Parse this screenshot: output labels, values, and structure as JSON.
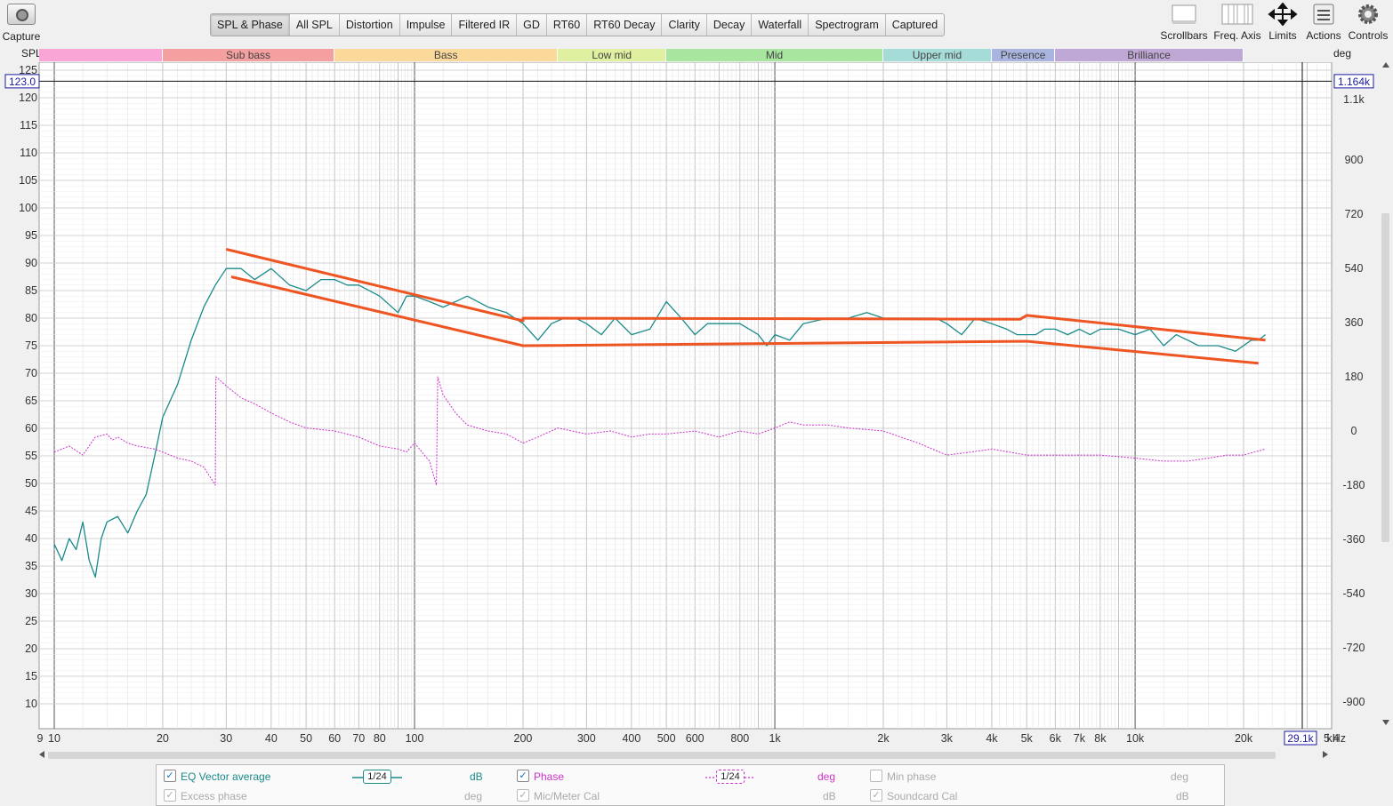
{
  "capture": {
    "label": "Capture"
  },
  "tabs": [
    "SPL & Phase",
    "All SPL",
    "Distortion",
    "Impulse",
    "Filtered IR",
    "GD",
    "RT60",
    "RT60 Decay",
    "Clarity",
    "Decay",
    "Waterfall",
    "Spectrogram",
    "Captured"
  ],
  "active_tab": "SPL & Phase",
  "tools": {
    "scrollbars": "Scrollbars",
    "freq_axis": "Freq. Axis",
    "limits": "Limits",
    "actions": "Actions",
    "controls": "Controls"
  },
  "bands": [
    {
      "label": "",
      "color": "#f9a6d6"
    },
    {
      "label": "Sub bass",
      "color": "#f5a0a0"
    },
    {
      "label": "Bass",
      "color": "#fbd99b"
    },
    {
      "label": "Low mid",
      "color": "#dff0a0"
    },
    {
      "label": "Mid",
      "color": "#a8e6a0"
    },
    {
      "label": "Upper mid",
      "color": "#a6dcd8"
    },
    {
      "label": "Presence",
      "color": "#a9b5e0"
    },
    {
      "label": "Brilliance",
      "color": "#c0a8d6"
    }
  ],
  "axes": {
    "left_title": "SPL",
    "right_title": "deg",
    "spl_ticks": [
      "125",
      "120",
      "115",
      "110",
      "105",
      "100",
      "95",
      "90",
      "85",
      "80",
      "75",
      "70",
      "65",
      "60",
      "55",
      "50",
      "45",
      "40",
      "35",
      "30",
      "25",
      "20",
      "15",
      "10"
    ],
    "deg_ticks": [
      "1.1k",
      "900",
      "720",
      "540",
      "360",
      "180",
      "0",
      "-180",
      "-360",
      "-540",
      "-720",
      "-900"
    ],
    "freq_ticks": [
      "9",
      "10",
      "20",
      "30",
      "40",
      "50",
      "60",
      "70",
      "80",
      "100",
      "200",
      "300",
      "400",
      "500",
      "600",
      "800",
      "1k",
      "2k",
      "3k",
      "4k",
      "5k",
      "6k",
      "7k",
      "8k",
      "10k",
      "20k"
    ],
    "freq_unit": "kHz",
    "freq_end": "5.4",
    "cursor_spl": "123.0",
    "cursor_deg": "1.164k",
    "cursor_freq": "29.1k"
  },
  "chart_data": {
    "type": "line",
    "x_scale": "log",
    "xlim": [
      9,
      35000
    ],
    "ylim": [
      5,
      127
    ],
    "xlabel": "",
    "ylabel": "SPL",
    "y2label": "deg",
    "series": [
      {
        "name": "EQ Vector average",
        "color": "#1a8a8a",
        "unit": "dB",
        "x": [
          10,
          10.5,
          11,
          11.5,
          12,
          12.5,
          13,
          13.5,
          14,
          15,
          16,
          17,
          18,
          19,
          20,
          22,
          24,
          26,
          28,
          30,
          33,
          36,
          40,
          45,
          50,
          55,
          60,
          65,
          70,
          80,
          90,
          95,
          100,
          110,
          120,
          130,
          140,
          160,
          180,
          200,
          220,
          240,
          260,
          280,
          300,
          330,
          360,
          400,
          450,
          500,
          550,
          600,
          650,
          700,
          800,
          900,
          950,
          1000,
          1100,
          1200,
          1400,
          1600,
          1800,
          2000,
          2200,
          2500,
          2800,
          3000,
          3300,
          3600,
          4000,
          4400,
          4700,
          5000,
          5300,
          5600,
          6000,
          6500,
          7000,
          7500,
          8000,
          8500,
          9000,
          10000,
          11000,
          12000,
          13000,
          14000,
          15000,
          17000,
          19000,
          20000,
          21000,
          22000,
          23000
        ],
        "y": [
          39,
          36,
          40,
          38,
          43,
          36,
          33,
          40,
          43,
          44,
          41,
          45,
          48,
          55,
          62,
          68,
          76,
          82,
          86,
          89,
          89,
          87,
          89,
          86,
          85,
          87,
          87,
          86,
          86,
          84,
          81,
          84,
          84,
          83,
          82,
          83,
          84,
          82,
          81,
          79,
          76,
          79,
          80,
          80,
          79,
          77,
          80,
          77,
          78,
          83,
          80,
          77,
          79,
          79,
          79,
          77,
          75,
          77,
          76,
          79,
          80,
          80,
          81,
          80,
          80,
          80,
          80,
          79,
          77,
          80,
          79,
          78,
          77,
          77,
          77,
          78,
          78,
          77,
          78,
          77,
          78,
          78,
          78,
          77,
          78,
          75,
          77,
          76,
          75,
          75,
          74,
          75,
          76,
          76,
          77
        ]
      },
      {
        "name": "Phase",
        "color": "#cc33cc",
        "unit": "deg",
        "x": [
          10,
          10.5,
          11,
          12,
          13,
          14,
          14.5,
          15,
          16,
          17,
          18,
          19,
          20,
          22,
          24,
          26,
          28,
          28.1,
          30,
          33,
          36,
          40,
          45,
          50,
          60,
          70,
          80,
          90,
          95,
          100,
          110,
          115,
          116,
          120,
          130,
          140,
          160,
          180,
          200,
          220,
          250,
          300,
          350,
          400,
          450,
          500,
          600,
          700,
          800,
          900,
          1000,
          1100,
          1200,
          1400,
          1600,
          2000,
          2500,
          3000,
          3500,
          4000,
          5000,
          6000,
          7000,
          8000,
          10000,
          12000,
          14000,
          16000,
          18000,
          20000,
          23000
        ],
        "y": [
          -70,
          -60,
          -50,
          -80,
          -20,
          -10,
          -30,
          -20,
          -40,
          -50,
          -55,
          -60,
          -70,
          -90,
          -100,
          -120,
          -180,
          180,
          150,
          110,
          90,
          60,
          30,
          10,
          0,
          -20,
          -50,
          -60,
          -70,
          -40,
          -100,
          -180,
          180,
          120,
          60,
          20,
          0,
          -10,
          -40,
          -20,
          10,
          -10,
          0,
          -20,
          -10,
          -10,
          0,
          -20,
          0,
          -10,
          10,
          30,
          20,
          20,
          10,
          0,
          -40,
          -80,
          -70,
          -60,
          -80,
          -80,
          -80,
          -80,
          -90,
          -100,
          -100,
          -90,
          -80,
          -80,
          -60
        ]
      },
      {
        "name": "Target upper",
        "color": "#ee5522",
        "unit": "dB",
        "x": [
          30,
          200,
          200,
          4800,
          5000,
          23000
        ],
        "y": [
          92.5,
          79.5,
          80,
          79.8,
          80.5,
          76
        ]
      },
      {
        "name": "Target lower",
        "color": "#ee5522",
        "unit": "dB",
        "x": [
          31,
          200,
          5000,
          22000
        ],
        "y": [
          87.5,
          75,
          75.8,
          71.8
        ]
      }
    ]
  },
  "legend": {
    "items": [
      {
        "name": "EQ Vector average",
        "checked": true,
        "smoothing": "1/24",
        "unit": "dB",
        "dim": false
      },
      {
        "name": "Phase",
        "checked": true,
        "smoothing": "1/24",
        "unit": "deg",
        "dim": false
      },
      {
        "name": "Min phase",
        "checked": false,
        "unit": "deg",
        "dim": true
      },
      {
        "name": "Excess phase",
        "checked": true,
        "unit": "deg",
        "dim": true
      },
      {
        "name": "Mic/Meter Cal",
        "checked": true,
        "unit": "dB",
        "dim": true
      },
      {
        "name": "Soundcard Cal",
        "checked": true,
        "unit": "dB",
        "dim": true
      }
    ]
  }
}
